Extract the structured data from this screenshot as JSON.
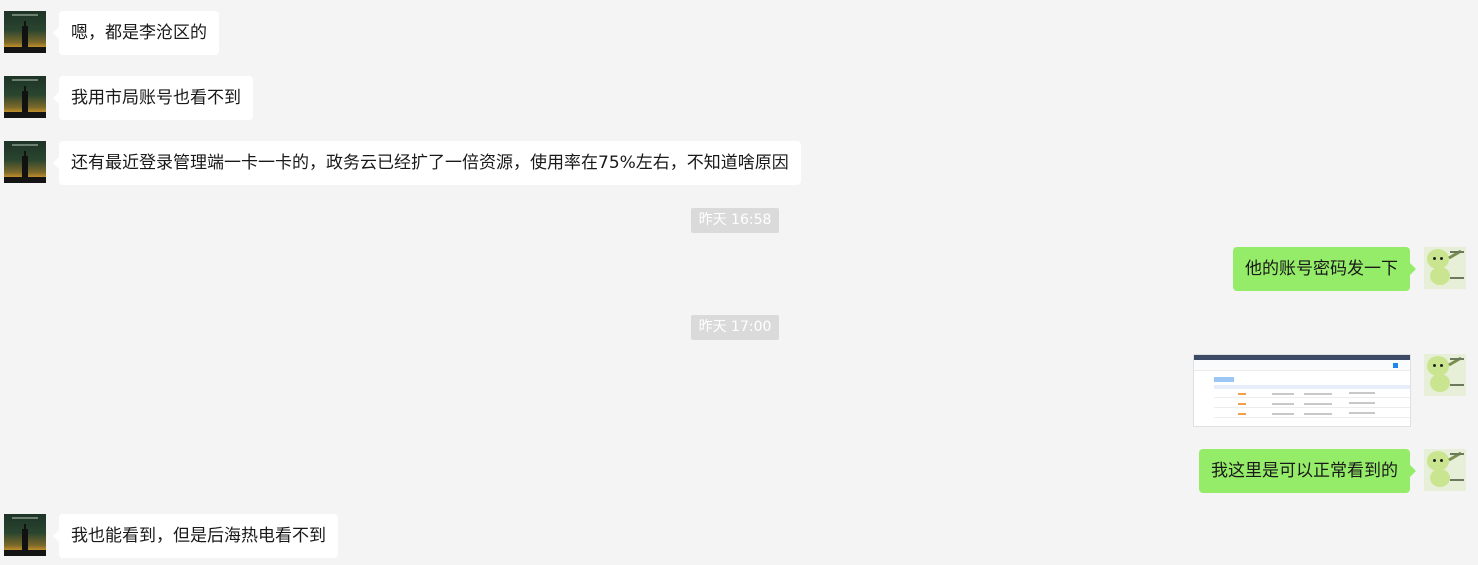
{
  "messages": [
    {
      "side": "left",
      "text": "嗯，都是李沧区的"
    },
    {
      "side": "left",
      "text": "我用市局账号也看不到"
    },
    {
      "side": "left",
      "text": "还有最近登录管理端一卡一卡的，政务云已经扩了一倍资源，使用率在75%左右，不知道啥原因"
    },
    {
      "side": "right",
      "text": "他的账号密码发一下"
    },
    {
      "side": "right",
      "text": "我这里是可以正常看到的"
    },
    {
      "side": "left",
      "text": "我也能看到，但是后海热电看不到"
    }
  ],
  "timestamps": [
    "昨天 16:58",
    "昨天 17:00"
  ],
  "colors": {
    "background": "#f4f4f4",
    "incoming_bubble": "#ffffff",
    "outgoing_bubble": "#95ec69",
    "timestamp_bg": "#dadada"
  }
}
